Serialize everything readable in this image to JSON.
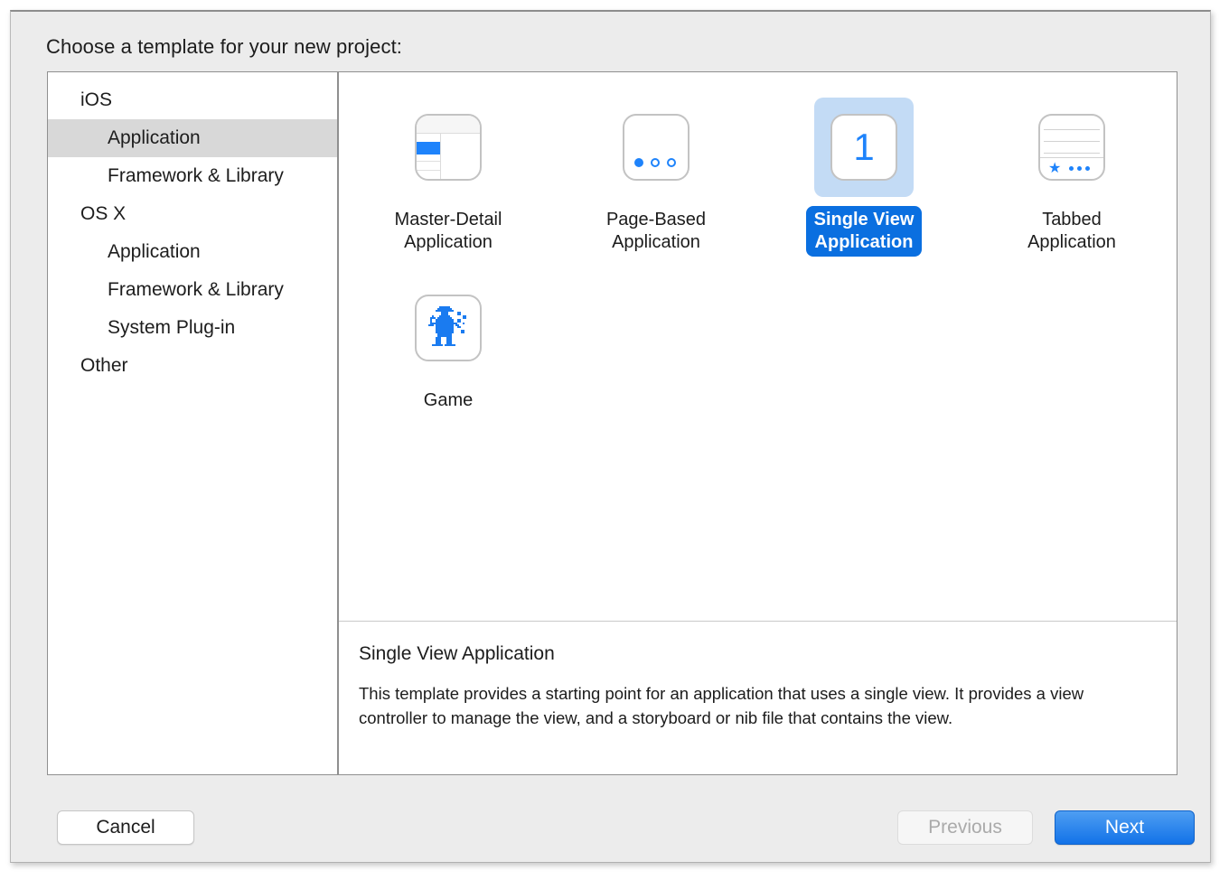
{
  "dialog": {
    "title": "Choose a template for your new project:"
  },
  "sidebar": {
    "items": [
      {
        "label": "iOS",
        "level": "group",
        "selected": false
      },
      {
        "label": "Application",
        "level": "child",
        "selected": true
      },
      {
        "label": "Framework & Library",
        "level": "child",
        "selected": false
      },
      {
        "label": "OS X",
        "level": "group",
        "selected": false
      },
      {
        "label": "Application",
        "level": "child",
        "selected": false
      },
      {
        "label": "Framework & Library",
        "level": "child",
        "selected": false
      },
      {
        "label": "System Plug-in",
        "level": "child",
        "selected": false
      },
      {
        "label": "Other",
        "level": "group",
        "selected": false
      }
    ]
  },
  "templates": {
    "row1": [
      {
        "label": "Master-Detail\nApplication",
        "icon": "master-detail-icon",
        "selected": false
      },
      {
        "label": "Page-Based\nApplication",
        "icon": "page-based-icon",
        "selected": false
      },
      {
        "label": "Single View\nApplication",
        "icon": "single-view-icon",
        "selected": true,
        "icon_text": "1"
      },
      {
        "label": "Tabbed\nApplication",
        "icon": "tabbed-icon",
        "selected": false
      }
    ],
    "row2": [
      {
        "label": "Game",
        "icon": "game-icon",
        "selected": false
      }
    ]
  },
  "description": {
    "title": "Single View Application",
    "body": "This template provides a starting point for an application that uses a single view. It provides a view controller to manage the view, and a storyboard or nib file that contains the view."
  },
  "footer": {
    "cancel_label": "Cancel",
    "previous_label": "Previous",
    "next_label": "Next"
  },
  "colors": {
    "accent_blue": "#1e83fb",
    "selected_pill": "#0a6fe0",
    "selection_halo": "#c3dbf5",
    "sidebar_selection": "#d8d8d8",
    "window_bg": "#ececec"
  }
}
